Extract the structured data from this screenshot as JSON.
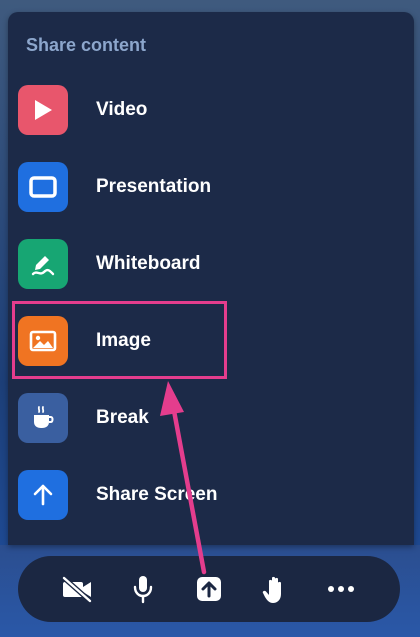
{
  "menu": {
    "header": "Share content",
    "items": [
      {
        "label": "Video",
        "icon": "play-icon",
        "color": "#e8566c"
      },
      {
        "label": "Presentation",
        "icon": "screen-icon",
        "color": "#1f6fe0"
      },
      {
        "label": "Whiteboard",
        "icon": "pen-icon",
        "color": "#17a673"
      },
      {
        "label": "Image",
        "icon": "image-icon",
        "color": "#f07422"
      },
      {
        "label": "Break",
        "icon": "coffee-icon",
        "color": "#3a5fa0"
      },
      {
        "label": "Share Screen",
        "icon": "upload-arrow-icon",
        "color": "#1f6fe0"
      }
    ]
  },
  "toolbar": {
    "buttons": [
      "camera-off-icon",
      "microphone-icon",
      "share-icon",
      "raise-hand-icon",
      "more-icon"
    ]
  },
  "annotation": {
    "highlight_color": "#e43d8d"
  }
}
